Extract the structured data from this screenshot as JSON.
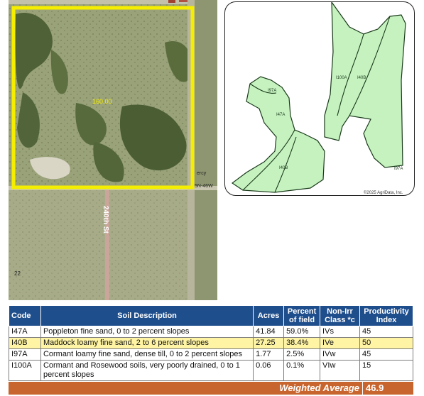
{
  "aerial": {
    "acreage_label": "160.00",
    "road_label": "240th St",
    "corner_label": "22",
    "edge_label_1": "ercy",
    "edge_label_2": "5N-46W"
  },
  "soil_map": {
    "copyright": "©2025 AgriData, Inc.",
    "polygon_labels": [
      "I97A",
      "I47A",
      "I40B",
      "I100A",
      "I40B",
      "I97A"
    ],
    "fill_color": "#c6f2c0",
    "outline_color": "#1a3a1a"
  },
  "table": {
    "headers": {
      "code": "Code",
      "description": "Soil Description",
      "acres": "Acres",
      "percent": "Percent of field",
      "class": "Non-Irr Class *c",
      "index": "Productivity Index"
    },
    "rows": [
      {
        "code": "I47A",
        "description": "Poppleton fine sand, 0 to 2 percent slopes",
        "acres": "41.84",
        "percent": "59.0%",
        "class": "IVs",
        "index": "45",
        "highlight": false
      },
      {
        "code": "I40B",
        "description": "Maddock loamy fine sand, 2 to 6 percent slopes",
        "acres": "27.25",
        "percent": "38.4%",
        "class": "IVe",
        "index": "50",
        "highlight": true
      },
      {
        "code": "I97A",
        "description": "Cormant loamy fine sand, dense till, 0 to 2 percent slopes",
        "acres": "1.77",
        "percent": "2.5%",
        "class": "IVw",
        "index": "45",
        "highlight": false
      },
      {
        "code": "I100A",
        "description": "Cormant and Rosewood soils, very poorly drained, 0 to 1 percent slopes",
        "acres": "0.06",
        "percent": "0.1%",
        "class": "VIw",
        "index": "15",
        "highlight": false
      }
    ],
    "weighted_average_label": "Weighted Average",
    "weighted_average_value": "46.9",
    "header_color": "#1f4e8c",
    "highlight_color": "#fff4a3",
    "footer_color": "#c8652e"
  }
}
